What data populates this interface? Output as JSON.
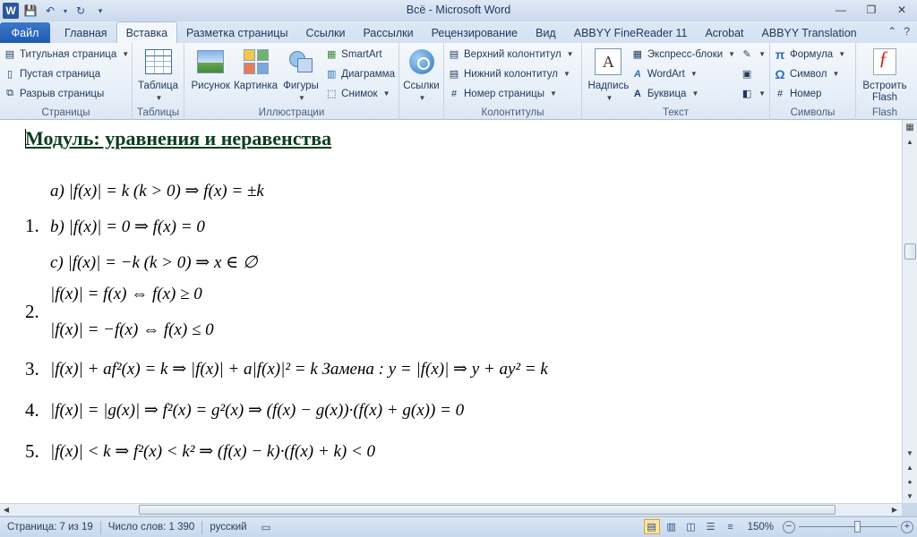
{
  "window": {
    "title": "Всё - Microsoft Word",
    "app_icon": "W"
  },
  "tabs": {
    "file": "Файл",
    "items": [
      "Главная",
      "Вставка",
      "Разметка страницы",
      "Ссылки",
      "Рассылки",
      "Рецензирование",
      "Вид",
      "ABBYY FineReader 11",
      "Acrobat",
      "ABBYY Translation"
    ],
    "active_index": 1
  },
  "ribbon": {
    "pages": {
      "label": "Страницы",
      "cover": "Титульная страница",
      "blank": "Пустая страница",
      "break": "Разрыв страницы"
    },
    "tables": {
      "label": "Таблицы",
      "table": "Таблица"
    },
    "illustrations": {
      "label": "Иллюстрации",
      "picture": "Рисунок",
      "clipart": "Картинка",
      "shapes": "Фигуры",
      "smartart": "SmartArt",
      "chart": "Диаграмма",
      "screenshot": "Снимок"
    },
    "links": {
      "label": "Ссылки",
      "links": "Ссылки"
    },
    "headerfooter": {
      "label": "Колонтитулы",
      "header": "Верхний колонтитул",
      "footer": "Нижний колонтитул",
      "pagenum": "Номер страницы"
    },
    "text": {
      "label": "Текст",
      "textbox": "Надпись",
      "quickparts": "Экспресс-блоки",
      "wordart": "WordArt",
      "dropcap": "Буквица"
    },
    "symbols": {
      "label": "Символы",
      "equation": "Формула",
      "symbol": "Символ",
      "number": "Номер"
    },
    "flash": {
      "label": "Flash",
      "embed_line1": "Встроить",
      "embed_line2": "Flash"
    }
  },
  "document": {
    "heading": "Модуль: уравнения и неравенства",
    "items": [
      {
        "num": "1."
      },
      {
        "num": "2."
      },
      {
        "num": "3."
      },
      {
        "num": "4."
      },
      {
        "num": "5."
      }
    ],
    "lines": {
      "l1a": "a) |f(x)| = k  (k > 0) ⇒ f(x) = ±k",
      "l1b": "b) |f(x)| = 0 ⇒ f(x) = 0",
      "l1c": "c) |f(x)| = −k (k > 0) ⇒ x ∈ ∅",
      "l2a": "|f(x)| = f(x) ⇔ f(x) ≥ 0",
      "l2b": "|f(x)| = −f(x) ⇔ f(x) ≤ 0",
      "l3": "|f(x)| + af²(x) = k ⇒ |f(x)| + a|f(x)|² = k    Замена : y = |f(x)| ⇒ y + ay² = k",
      "l4": "|f(x)| = |g(x)|  ⇒ f²(x) = g²(x) ⇒ (f(x) − g(x))·(f(x) + g(x)) = 0",
      "l5": "|f(x)| < k  ⇒ f²(x) < k² ⇒ (f(x) − k)·(f(x) + k) < 0"
    }
  },
  "status": {
    "page": "Страница: 7 из 19",
    "words": "Число слов: 1 390",
    "language": "русский",
    "zoom": "150%",
    "zoom_level": 0.6
  }
}
